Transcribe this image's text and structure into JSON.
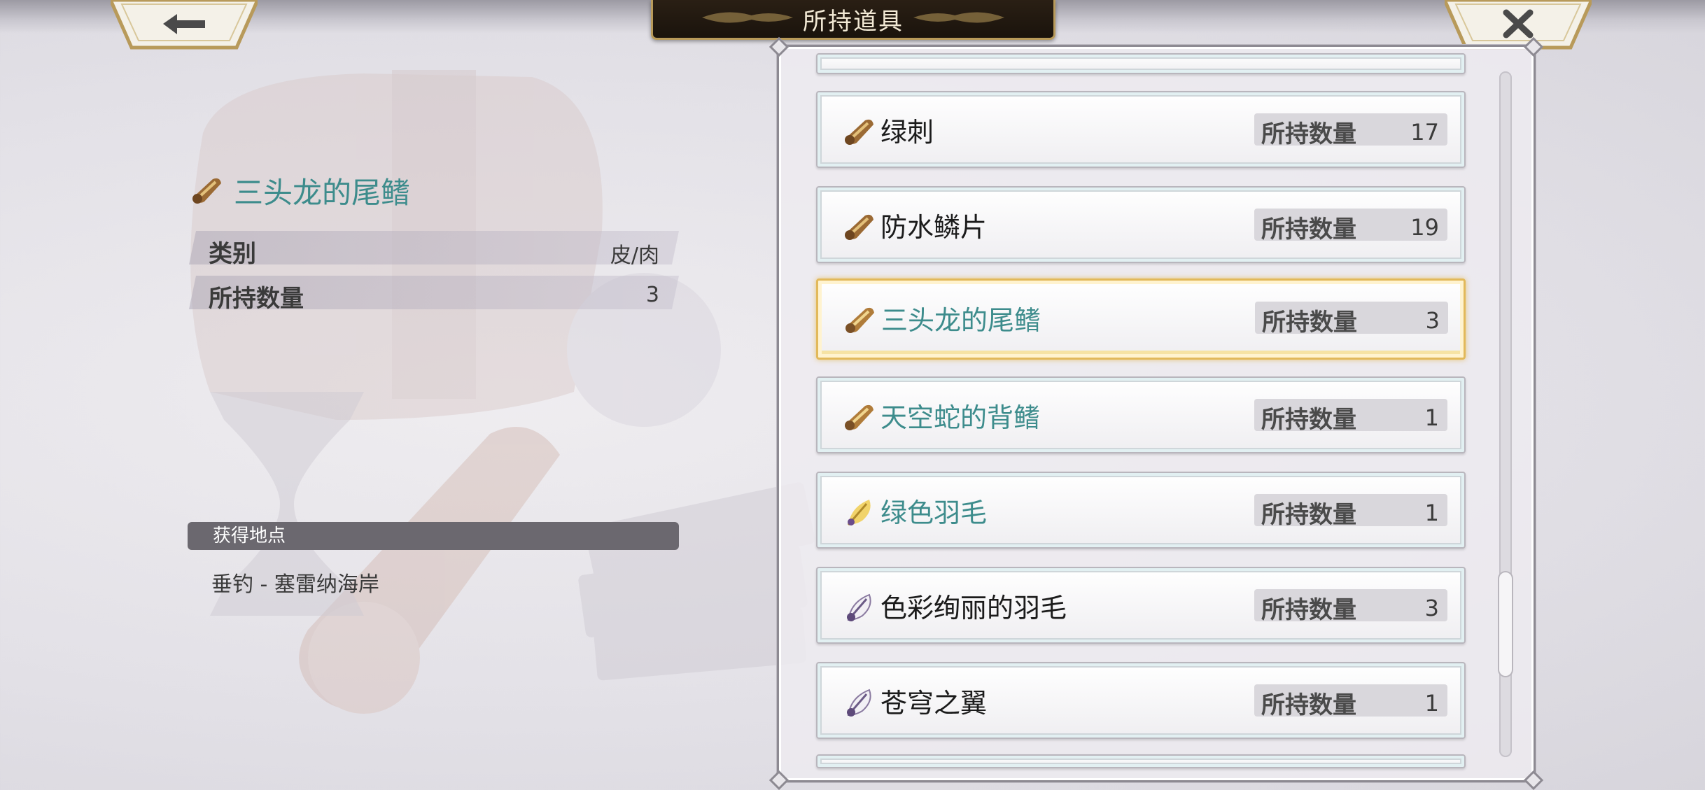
{
  "header": {
    "title": "所持道具",
    "back_icon": "arrow-left-icon",
    "close_icon": "close-x-icon"
  },
  "detail": {
    "item_icon": "scroll-material-icon",
    "item_name": "三头龙的尾鳍",
    "rows": [
      {
        "key": "类别",
        "value": "皮/肉"
      },
      {
        "key": "所持数量",
        "value": "3"
      }
    ],
    "obtain_header": "获得地点",
    "obtain_location": "垂钓 - 塞雷纳海岸"
  },
  "list": {
    "qty_label": "所持数量",
    "items": [
      {
        "name": "绿刺",
        "qty": "17",
        "icon": "scroll-material-icon",
        "teal": false,
        "selected": false
      },
      {
        "name": "防水鳞片",
        "qty": "19",
        "icon": "scroll-material-icon",
        "teal": false,
        "selected": false
      },
      {
        "name": "三头龙的尾鳍",
        "qty": "3",
        "icon": "scroll-material-icon",
        "teal": true,
        "selected": true
      },
      {
        "name": "天空蛇的背鳍",
        "qty": "1",
        "icon": "scroll-material-icon",
        "teal": true,
        "selected": false
      },
      {
        "name": "绿色羽毛",
        "qty": "1",
        "icon": "yellow-feather-icon",
        "teal": true,
        "selected": false
      },
      {
        "name": "色彩绚丽的羽毛",
        "qty": "3",
        "icon": "purple-feather-icon",
        "teal": false,
        "selected": false
      },
      {
        "name": "苍穹之翼",
        "qty": "1",
        "icon": "purple-feather-icon",
        "teal": false,
        "selected": false
      }
    ],
    "scroll_position": 0.86
  },
  "colors": {
    "accent_teal": "#3d8c8c",
    "selected_gold": "#e2b95a",
    "title_plate": "#1a130c"
  }
}
